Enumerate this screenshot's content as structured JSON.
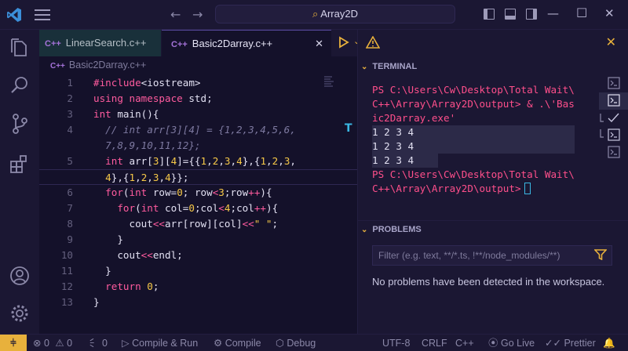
{
  "titlebar": {
    "search_text": "Array2D",
    "back_glyph": "←",
    "forward_glyph": "→"
  },
  "tabs": [
    {
      "label": "LinearSearch.c++",
      "icon": "c-plus-plus-icon"
    },
    {
      "label": "Basic2Darray.c++",
      "icon": "c-plus-plus-icon",
      "active": true
    }
  ],
  "breadcrumb": "Basic2Darray.c++",
  "code_lines": [
    "1",
    "2",
    "3",
    "4",
    "",
    "5",
    "",
    "6",
    "7",
    "8",
    "9",
    "10",
    "11",
    "12",
    "13"
  ],
  "panel": {
    "terminal_label": "TERMINAL",
    "problems_label": "PROBLEMS",
    "terminal_lines": [
      "PS C:\\Users\\Cw\\Desktop\\Total Wait\\",
      "C++\\Array\\Array2D\\output> & .\\'Bas",
      "ic2Darray.exe'",
      "1 2 3 4",
      "1 2 3 4",
      "1 2 3 4",
      "PS C:\\Users\\Cw\\Desktop\\Total Wait\\",
      "C++\\Array\\Array2D\\output>"
    ],
    "filter_placeholder": "Filter (e.g. text, **/*.ts, !**/node_modules/**)",
    "problems_message": "No problems have been detected in the workspace."
  },
  "statusbar": {
    "errors": "0",
    "warnings": "0",
    "ports": "0",
    "compile_run": "Compile & Run",
    "compile": "Compile",
    "debug": "Debug",
    "encoding": "UTF-8",
    "eol": "CRLF",
    "language": "C++",
    "golive": "Go Live",
    "prettier": "Prettier"
  },
  "colors": {
    "accent": "#e8b13c",
    "keyword": "#ff5b9e",
    "number": "#f7c948",
    "background": "#14112a"
  }
}
